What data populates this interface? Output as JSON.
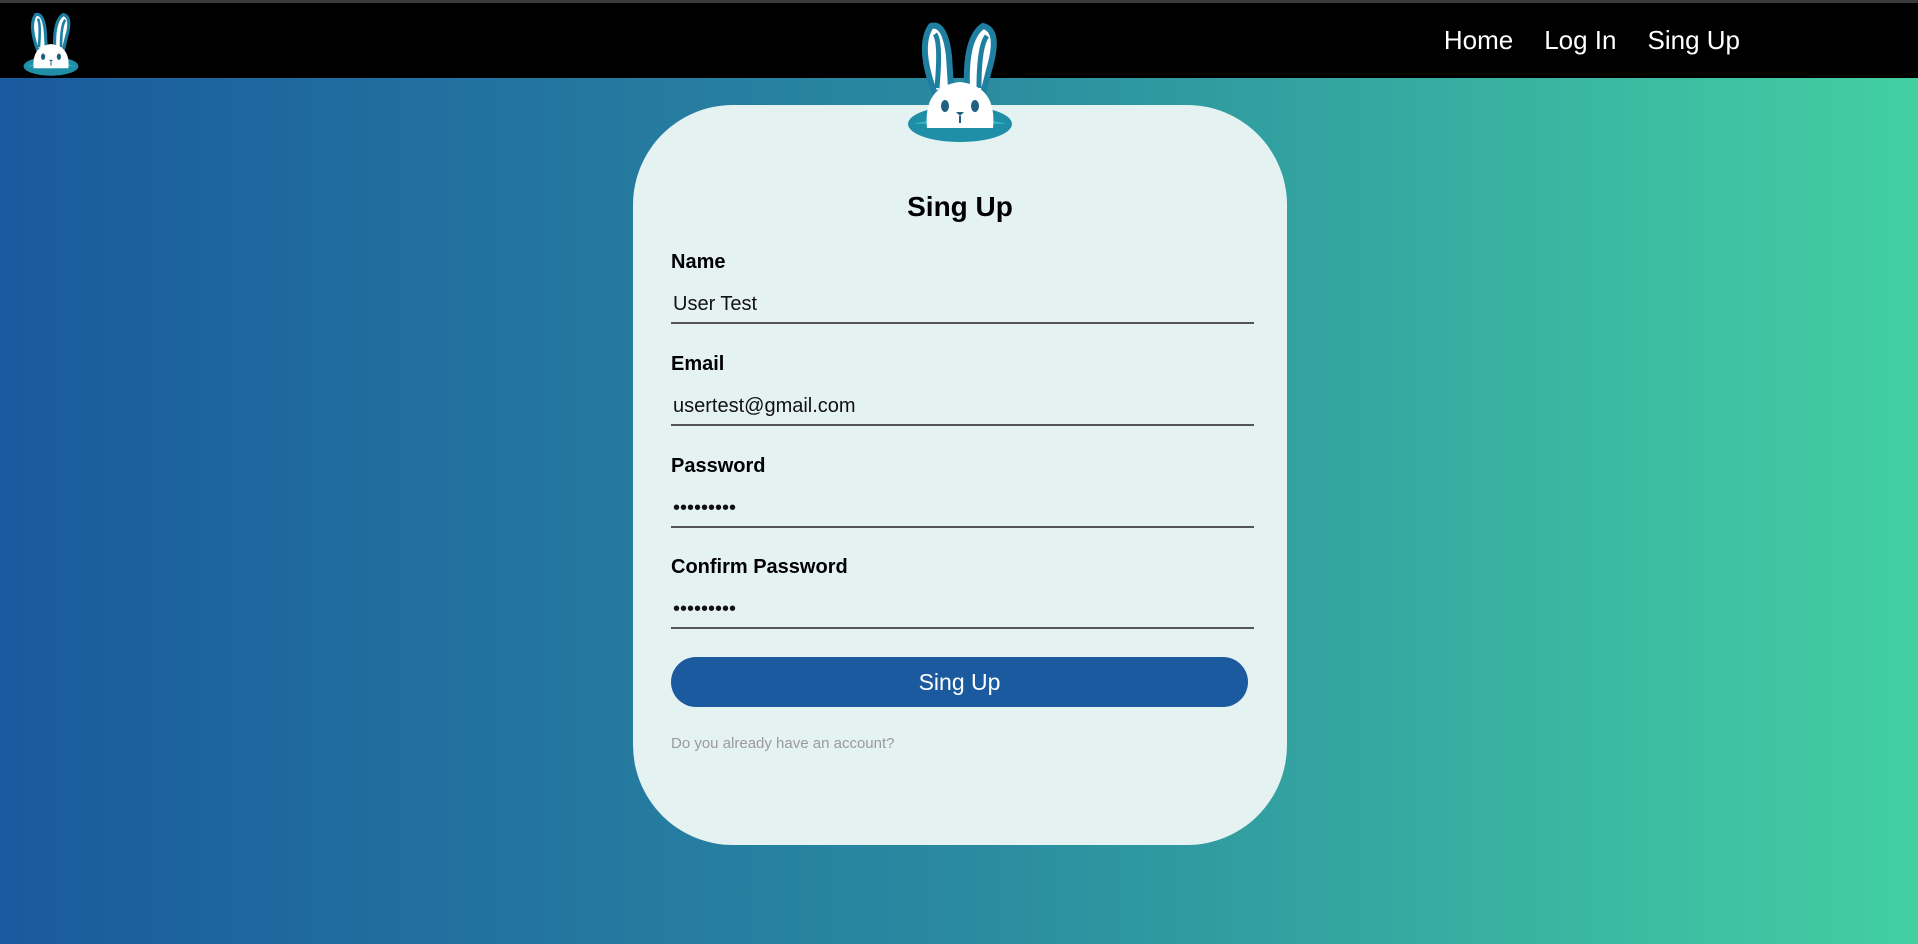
{
  "header": {
    "logo_icon": "bunny-icon",
    "nav": [
      {
        "label": "Home"
      },
      {
        "label": "Log In"
      },
      {
        "label": "Sing Up"
      }
    ]
  },
  "form": {
    "logo_icon": "bunny-icon",
    "title": "Sing Up",
    "fields": {
      "name": {
        "label": "Name",
        "value": "User Test"
      },
      "email": {
        "label": "Email",
        "value": "usertest@gmail.com"
      },
      "password": {
        "label": "Password",
        "value": "•••••••••"
      },
      "confirm_password": {
        "label": "Confirm Password",
        "value": "•••••••••"
      }
    },
    "submit_label": "Sing Up",
    "account_link": "Do you already have an account?"
  },
  "colors": {
    "navbar": "#000000",
    "card": "#e5f2f2",
    "button": "#1b5a9e",
    "gradient_start": "#1a5a9e",
    "gradient_end": "#43cfa2"
  }
}
